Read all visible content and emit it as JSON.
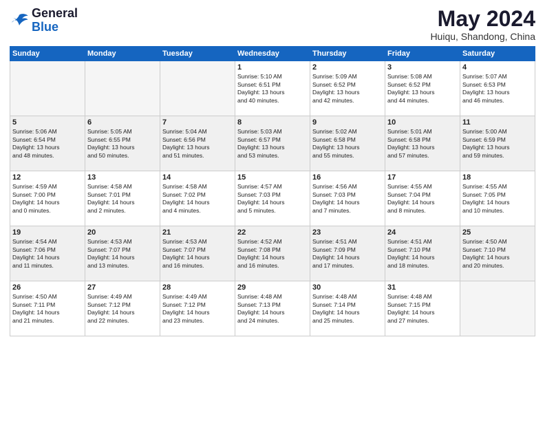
{
  "header": {
    "logo_line1": "General",
    "logo_line2": "Blue",
    "month": "May 2024",
    "location": "Huiqu, Shandong, China"
  },
  "days_of_week": [
    "Sunday",
    "Monday",
    "Tuesday",
    "Wednesday",
    "Thursday",
    "Friday",
    "Saturday"
  ],
  "weeks": [
    [
      {
        "day": "",
        "info": ""
      },
      {
        "day": "",
        "info": ""
      },
      {
        "day": "",
        "info": ""
      },
      {
        "day": "1",
        "info": "Sunrise: 5:10 AM\nSunset: 6:51 PM\nDaylight: 13 hours\nand 40 minutes."
      },
      {
        "day": "2",
        "info": "Sunrise: 5:09 AM\nSunset: 6:52 PM\nDaylight: 13 hours\nand 42 minutes."
      },
      {
        "day": "3",
        "info": "Sunrise: 5:08 AM\nSunset: 6:52 PM\nDaylight: 13 hours\nand 44 minutes."
      },
      {
        "day": "4",
        "info": "Sunrise: 5:07 AM\nSunset: 6:53 PM\nDaylight: 13 hours\nand 46 minutes."
      }
    ],
    [
      {
        "day": "5",
        "info": "Sunrise: 5:06 AM\nSunset: 6:54 PM\nDaylight: 13 hours\nand 48 minutes."
      },
      {
        "day": "6",
        "info": "Sunrise: 5:05 AM\nSunset: 6:55 PM\nDaylight: 13 hours\nand 50 minutes."
      },
      {
        "day": "7",
        "info": "Sunrise: 5:04 AM\nSunset: 6:56 PM\nDaylight: 13 hours\nand 51 minutes."
      },
      {
        "day": "8",
        "info": "Sunrise: 5:03 AM\nSunset: 6:57 PM\nDaylight: 13 hours\nand 53 minutes."
      },
      {
        "day": "9",
        "info": "Sunrise: 5:02 AM\nSunset: 6:58 PM\nDaylight: 13 hours\nand 55 minutes."
      },
      {
        "day": "10",
        "info": "Sunrise: 5:01 AM\nSunset: 6:58 PM\nDaylight: 13 hours\nand 57 minutes."
      },
      {
        "day": "11",
        "info": "Sunrise: 5:00 AM\nSunset: 6:59 PM\nDaylight: 13 hours\nand 59 minutes."
      }
    ],
    [
      {
        "day": "12",
        "info": "Sunrise: 4:59 AM\nSunset: 7:00 PM\nDaylight: 14 hours\nand 0 minutes."
      },
      {
        "day": "13",
        "info": "Sunrise: 4:58 AM\nSunset: 7:01 PM\nDaylight: 14 hours\nand 2 minutes."
      },
      {
        "day": "14",
        "info": "Sunrise: 4:58 AM\nSunset: 7:02 PM\nDaylight: 14 hours\nand 4 minutes."
      },
      {
        "day": "15",
        "info": "Sunrise: 4:57 AM\nSunset: 7:03 PM\nDaylight: 14 hours\nand 5 minutes."
      },
      {
        "day": "16",
        "info": "Sunrise: 4:56 AM\nSunset: 7:03 PM\nDaylight: 14 hours\nand 7 minutes."
      },
      {
        "day": "17",
        "info": "Sunrise: 4:55 AM\nSunset: 7:04 PM\nDaylight: 14 hours\nand 8 minutes."
      },
      {
        "day": "18",
        "info": "Sunrise: 4:55 AM\nSunset: 7:05 PM\nDaylight: 14 hours\nand 10 minutes."
      }
    ],
    [
      {
        "day": "19",
        "info": "Sunrise: 4:54 AM\nSunset: 7:06 PM\nDaylight: 14 hours\nand 11 minutes."
      },
      {
        "day": "20",
        "info": "Sunrise: 4:53 AM\nSunset: 7:07 PM\nDaylight: 14 hours\nand 13 minutes."
      },
      {
        "day": "21",
        "info": "Sunrise: 4:53 AM\nSunset: 7:07 PM\nDaylight: 14 hours\nand 16 minutes."
      },
      {
        "day": "22",
        "info": "Sunrise: 4:52 AM\nSunset: 7:08 PM\nDaylight: 14 hours\nand 16 minutes."
      },
      {
        "day": "23",
        "info": "Sunrise: 4:51 AM\nSunset: 7:09 PM\nDaylight: 14 hours\nand 17 minutes."
      },
      {
        "day": "24",
        "info": "Sunrise: 4:51 AM\nSunset: 7:10 PM\nDaylight: 14 hours\nand 18 minutes."
      },
      {
        "day": "25",
        "info": "Sunrise: 4:50 AM\nSunset: 7:10 PM\nDaylight: 14 hours\nand 20 minutes."
      }
    ],
    [
      {
        "day": "26",
        "info": "Sunrise: 4:50 AM\nSunset: 7:11 PM\nDaylight: 14 hours\nand 21 minutes."
      },
      {
        "day": "27",
        "info": "Sunrise: 4:49 AM\nSunset: 7:12 PM\nDaylight: 14 hours\nand 22 minutes."
      },
      {
        "day": "28",
        "info": "Sunrise: 4:49 AM\nSunset: 7:12 PM\nDaylight: 14 hours\nand 23 minutes."
      },
      {
        "day": "29",
        "info": "Sunrise: 4:48 AM\nSunset: 7:13 PM\nDaylight: 14 hours\nand 24 minutes."
      },
      {
        "day": "30",
        "info": "Sunrise: 4:48 AM\nSunset: 7:14 PM\nDaylight: 14 hours\nand 25 minutes."
      },
      {
        "day": "31",
        "info": "Sunrise: 4:48 AM\nSunset: 7:15 PM\nDaylight: 14 hours\nand 27 minutes."
      },
      {
        "day": "",
        "info": ""
      }
    ]
  ]
}
